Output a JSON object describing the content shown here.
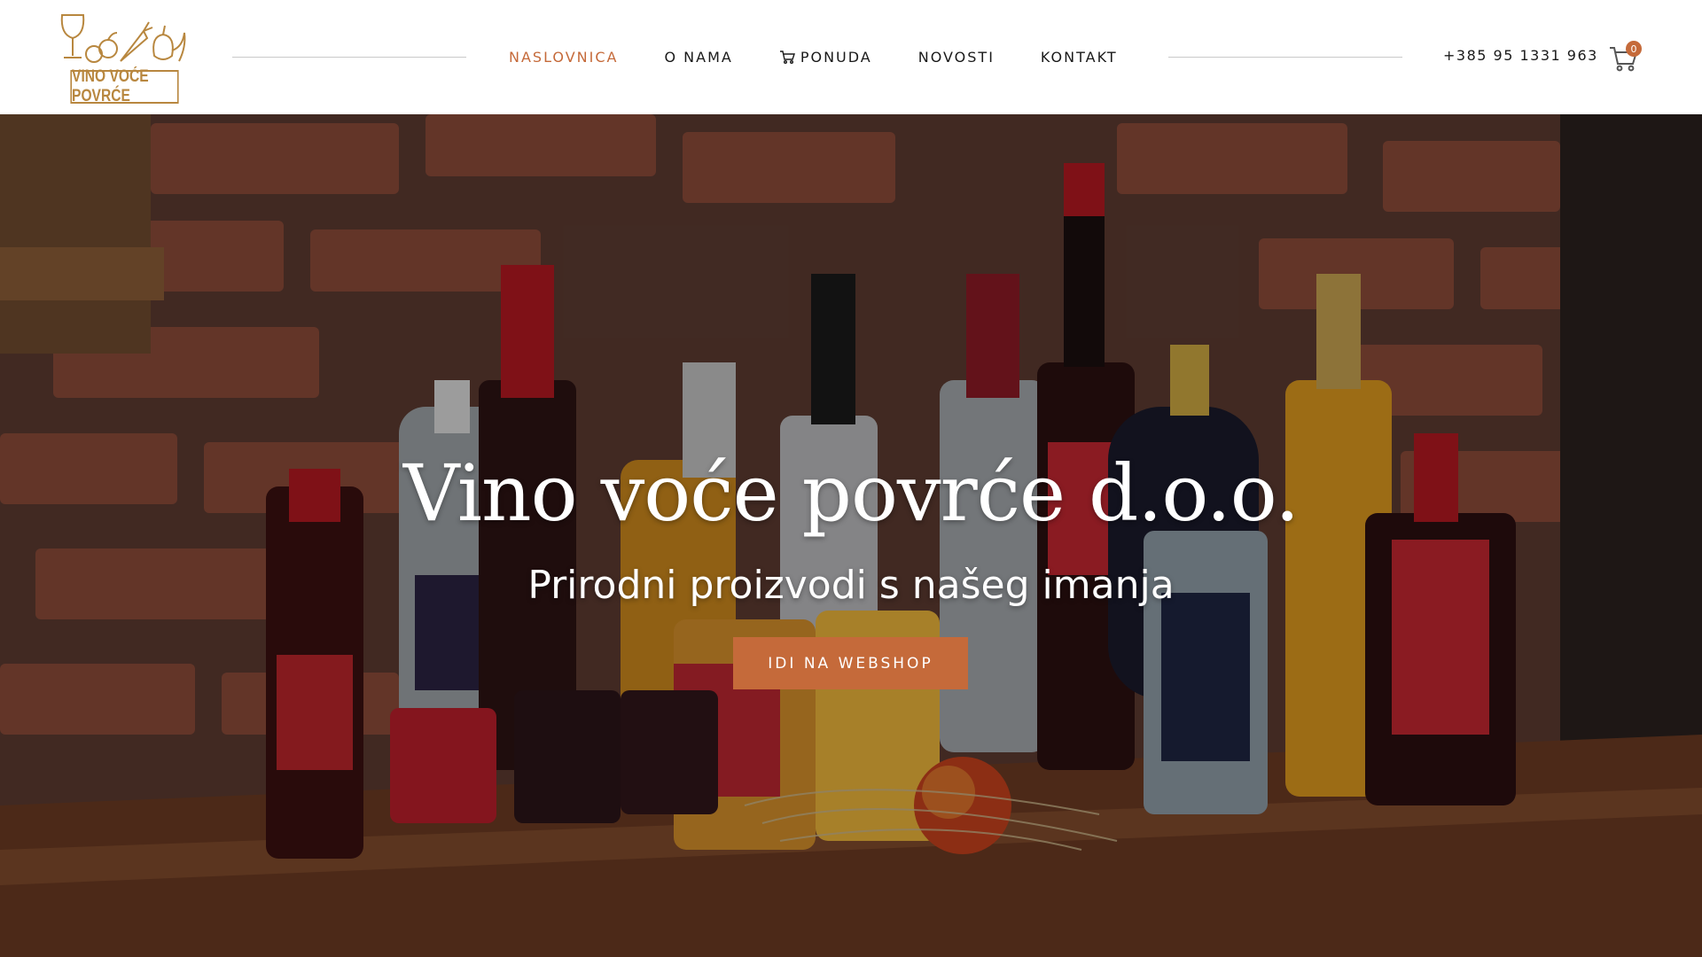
{
  "brand": {
    "logo_text": "VINO VOĆE POVRĆE",
    "logo_icon": "wine-fruit-vegetable-icon",
    "accent_color": "#c56a3a",
    "logo_color": "#b8873f"
  },
  "nav": {
    "items": [
      {
        "label": "NASLOVNICA",
        "active": true
      },
      {
        "label": "O NAMA",
        "active": false
      },
      {
        "label": "PONUDA",
        "active": false,
        "icon": "cart-icon"
      },
      {
        "label": "NOVOSTI",
        "active": false
      },
      {
        "label": "KONTAKT",
        "active": false
      }
    ]
  },
  "header": {
    "phone": "+385 95 1331 963",
    "cart_count": "0",
    "cart_icon": "shopping-cart-icon"
  },
  "hero": {
    "title": "Vino voće povrće d.o.o.",
    "subtitle": "Prirodni proizvodi s našeg imanja",
    "button_label": "IDI NA WEBSHOP"
  }
}
